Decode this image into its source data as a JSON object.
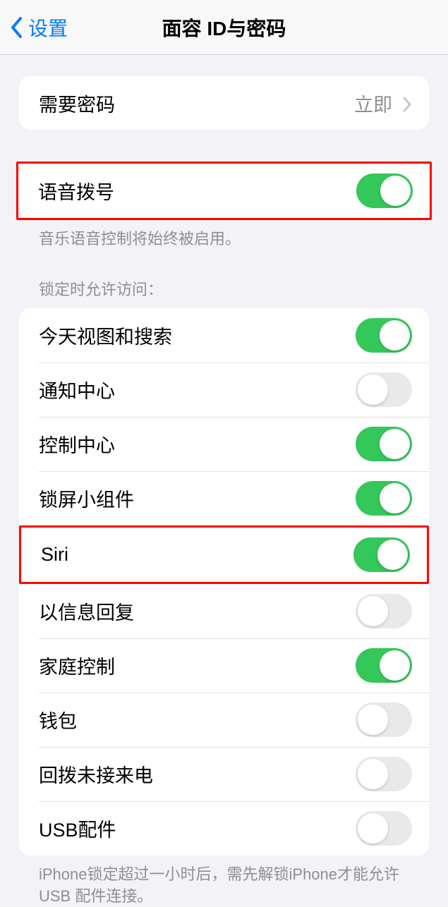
{
  "header": {
    "back_label": "设置",
    "title": "面容 ID与密码"
  },
  "passcode_row": {
    "label": "需要密码",
    "value": "立即"
  },
  "voice_dial": {
    "label": "语音拨号",
    "on": true,
    "footer": "音乐语音控制将始终被启用。"
  },
  "lock_section": {
    "header": "锁定时允许访问：",
    "items": [
      {
        "label": "今天视图和搜索",
        "on": true
      },
      {
        "label": "通知中心",
        "on": false
      },
      {
        "label": "控制中心",
        "on": true
      },
      {
        "label": "锁屏小组件",
        "on": true
      },
      {
        "label": "Siri",
        "on": true
      },
      {
        "label": "以信息回复",
        "on": false
      },
      {
        "label": "家庭控制",
        "on": true
      },
      {
        "label": "钱包",
        "on": false
      },
      {
        "label": "回拨未接来电",
        "on": false
      },
      {
        "label": "USB配件",
        "on": false
      }
    ],
    "footer": "iPhone锁定超过一小时后，需先解锁iPhone才能允许USB 配件连接。"
  }
}
